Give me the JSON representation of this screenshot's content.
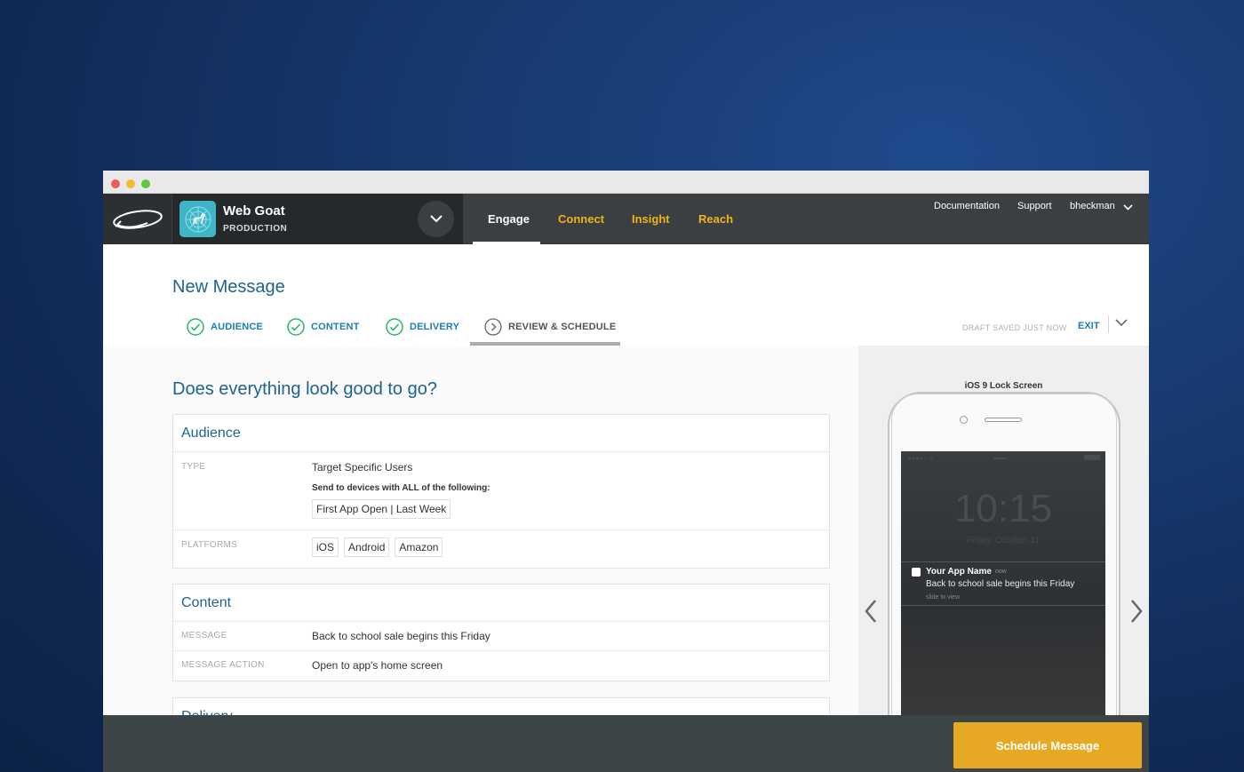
{
  "appbar": {
    "app_name": "Web Goat",
    "app_env": "PRODUCTION",
    "nav": [
      {
        "label": "Engage",
        "active": true
      },
      {
        "label": "Connect"
      },
      {
        "label": "Insight"
      },
      {
        "label": "Reach"
      }
    ],
    "links": {
      "documentation": "Documentation",
      "support": "Support",
      "user": "bheckman"
    }
  },
  "header": {
    "title": "New Message",
    "steps": [
      {
        "label": "AUDIENCE",
        "status": "complete"
      },
      {
        "label": "CONTENT",
        "status": "complete"
      },
      {
        "label": "DELIVERY",
        "status": "complete"
      },
      {
        "label": "REVIEW & SCHEDULE",
        "status": "current"
      }
    ],
    "draft_status": "DRAFT SAVED JUST NOW",
    "exit_label": "EXIT"
  },
  "review": {
    "question": "Does everything look good to go?",
    "audience": {
      "title": "Audience",
      "type_label": "TYPE",
      "type_value": "Target Specific Users",
      "condition_text": "Send to devices with ALL of the following:",
      "condition_chip": "First App Open | Last Week",
      "platforms_label": "PLATFORMS",
      "platforms": [
        "iOS",
        "Android",
        "Amazon"
      ]
    },
    "content": {
      "title": "Content",
      "message_label": "MESSAGE",
      "message_value": "Back to school sale begins this Friday",
      "action_label": "MESSAGE ACTION",
      "action_value": "Open to app's home screen"
    },
    "delivery": {
      "title": "Delivery"
    }
  },
  "preview": {
    "title": "iOS 9 Lock Screen",
    "clock": "10:15",
    "date": "Friday, October 31",
    "notification": {
      "app_name": "Your App Name",
      "time": "now",
      "message": "Back to school sale begins this Friday",
      "slide_text": "slide to view"
    }
  },
  "footer": {
    "schedule_label": "Schedule Message"
  },
  "colors": {
    "accent_blue": "#1b7db8",
    "gold": "#f0b41a",
    "button": "#e7a924",
    "check_green": "#2bb36b"
  }
}
